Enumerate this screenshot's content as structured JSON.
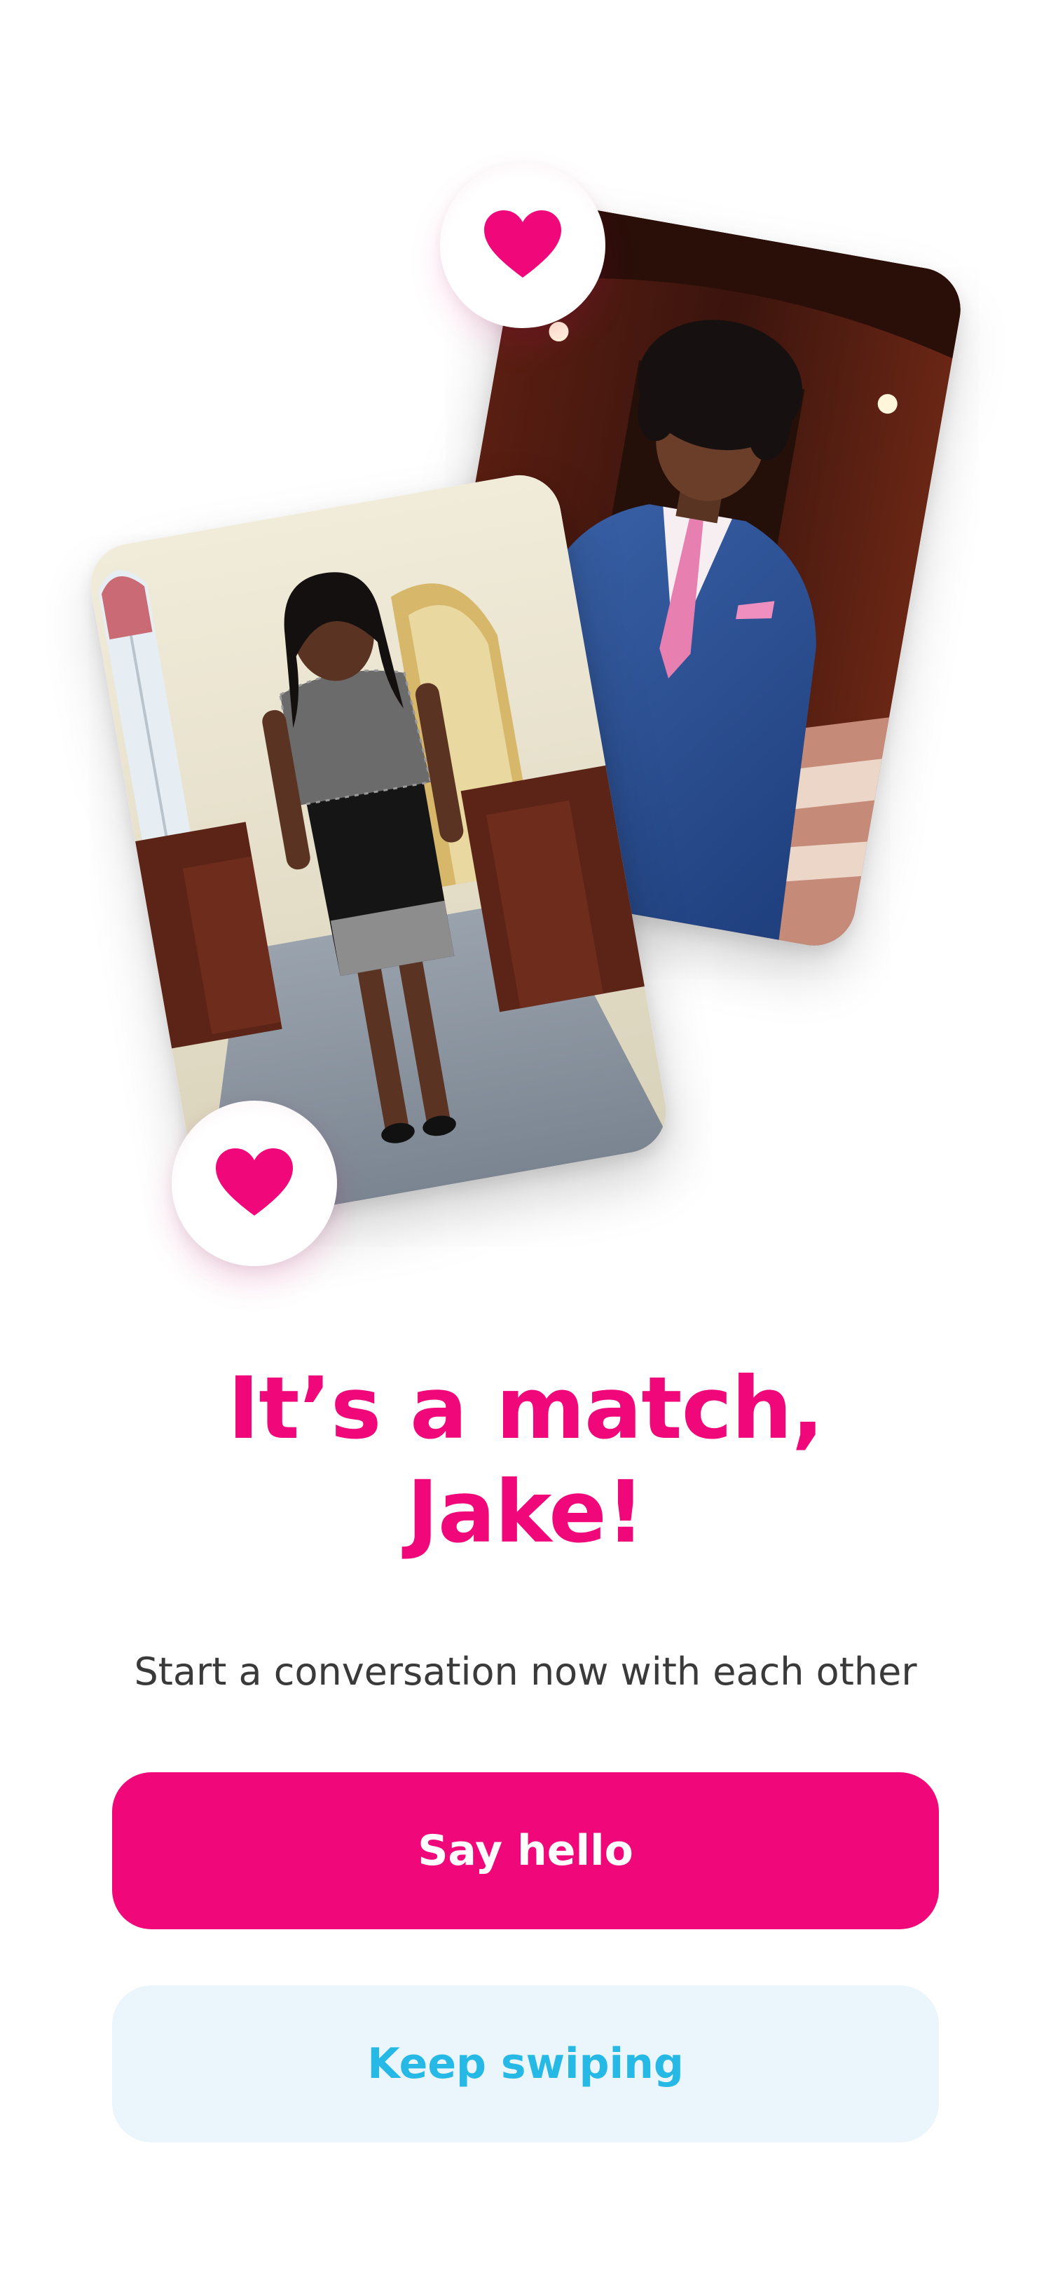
{
  "match": {
    "headline_line1": "It’s a match,",
    "headline_line2": "Jake!",
    "subtitle": "Start a conversation now with each other"
  },
  "actions": {
    "primary_label": "Say hello",
    "secondary_label": "Keep swiping"
  },
  "photos": {
    "back_card": "man-in-blue-suit-photo",
    "front_card": "woman-in-black-dress-photo"
  },
  "icons": {
    "badge_top": "heart-icon",
    "badge_bottom": "heart-icon"
  },
  "colors": {
    "accent": "#f0077a",
    "secondary_button_bg": "#eaf6fb",
    "secondary_button_text": "#27b9e6",
    "subtitle": "#3a3a3a"
  }
}
